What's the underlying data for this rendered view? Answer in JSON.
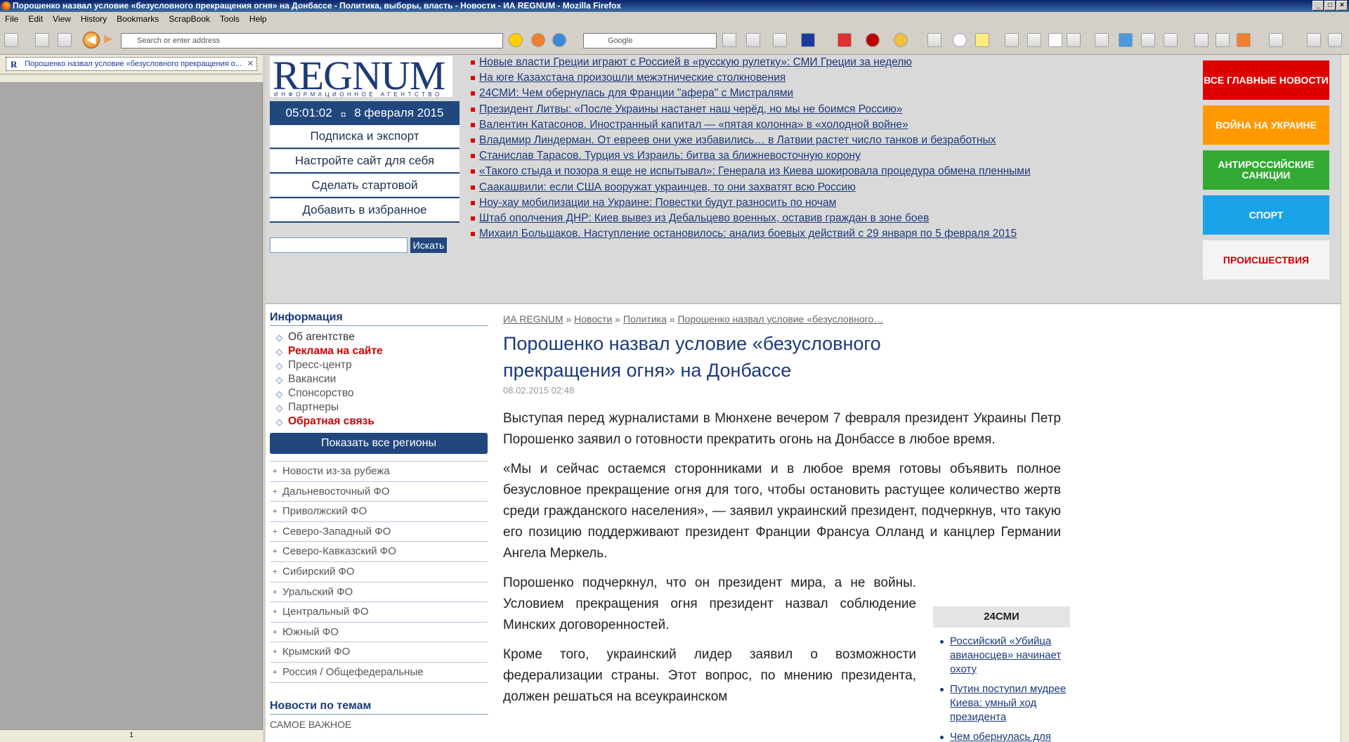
{
  "window": {
    "title": "Порошенко назвал условие «безусловного прекращения огня» на Донбассе - Политика, выборы, власть - Новости - ИА REGNUM - Mozilla Firefox"
  },
  "menu": [
    "File",
    "Edit",
    "View",
    "History",
    "Bookmarks",
    "ScrapBook",
    "Tools",
    "Help"
  ],
  "toolbar": {
    "address_placeholder": "Search or enter address",
    "search_placeholder": "Google"
  },
  "sidebar": {
    "tab_title": "Порошенко назвал условие «безусловного прекращения о...",
    "page_number": "1"
  },
  "site": {
    "logo": "REGNUM",
    "logo_sub": "ИНФОРМАЦИОННОЕ АГЕНТСТВО",
    "time": "05:01:02",
    "date": "8 февраля 2015",
    "links": [
      "Подписка и экспорт",
      "Настройте сайт для себя",
      "Сделать стартовой",
      "Добавить в избранное"
    ],
    "search_button": "Искать"
  },
  "headlines": [
    "Новые власти Греции играют с Россией в «русскую рулетку»: СМИ Греции за неделю",
    "На юге Казахстана произошли межэтнические столкновения",
    "24СМИ: Чем обернулась для Франции \"афера\" с Мистралями",
    "Президент Литвы: «После Украины настанет наш черёд, но мы не боимся Россию»",
    "Валентин Катасонов. Иностранный капитал — «пятая колонна» в «холодной войне»",
    "Владимир Линдерман. От евреев они уже избавились… в Латвии растет число танков и безработных",
    "Станислав Тарасов. Турция vs Израиль: битва за ближневосточную корону",
    "«Такого стыда и позора я еще не испытывал»: Генерала из Киева шокировала процедура обмена пленными",
    "Саакашвили: если США вооружат украинцев, то они захватят всю Россию",
    "Ноу-хау мобилизации на Украине: Повестки будут разносить по ночам",
    "Штаб ополчения ДНР: Киев вывез из Дебальцево военных, оставив граждан в зоне боев",
    "Михаил Большаков. Наступление остановилось: анализ боевых действий с 29 января по 5 февраля 2015"
  ],
  "categories": [
    {
      "label": "ВСЕ ГЛАВНЫЕ НОВОСТИ",
      "color": "#dd0000"
    },
    {
      "label": "ВОЙНА НА УКРАИНЕ",
      "color": "#ff9900"
    },
    {
      "label": "АНТИРОССИЙСКИЕ САНКЦИИ",
      "color": "#33aa33"
    },
    {
      "label": "СПОРТ",
      "color": "#1aa3e8"
    },
    {
      "label": "ПРОИСШЕСТВИЯ",
      "color": "#f4f4f4"
    }
  ],
  "info": {
    "title": "Информация",
    "items": [
      "Об агентстве",
      "Реклама на сайте",
      "Пресс-центр",
      "Вакансии",
      "Спонсорство",
      "Партнеры",
      "Обратная связь"
    ],
    "show_regions": "Показать все регионы",
    "regions": [
      "Новости из-за рубежа",
      "Дальневосточный ФО",
      "Приволжский ФО",
      "Северо-Западный ФО",
      "Северо-Кавказский ФО",
      "Сибирский ФО",
      "Уральский ФО",
      "Центральный ФО",
      "Южный ФО",
      "Крымский ФО",
      "Россия / Общефедеральные"
    ],
    "topics_title": "Новости по темам",
    "topics_first": "САМОЕ ВАЖНОЕ"
  },
  "article": {
    "crumbs": [
      "ИА REGNUM",
      "Новости",
      "Политика",
      "Порошенко назвал условие «безусловного…"
    ],
    "title": "Порошенко назвал условие «безусловного прекращения огня» на Донбассе",
    "date": "08.02.2015 02:48",
    "paragraphs": [
      "Выступая перед журналистами в Мюнхене вечером 7 февраля президент Украины Петр Порошенко заявил о готовности прекратить огонь на Донбассе в любое время.",
      "«Мы и сейчас остаемся сторонниками и в любое время готовы объявить полное безусловное прекращение огня для того, чтобы остановить растущее количество жертв среди гражданского населения», — заявил украинский президент, подчеркнув, что такую его позицию поддерживают президент Франции Франсуа Олланд и канцлер Германии Ангела Меркель.",
      "Порошенко подчеркнул, что он президент мира, а не войны. Условием прекращения огня президент назвал соблюдение Минских договоренностей.",
      "Кроме того, украинский лидер заявил о возможности федерализации страны. Этот вопрос, по мнению президента, должен решаться на всеукраинском"
    ]
  },
  "smi": {
    "title": "24СМИ",
    "items": [
      "Российский «Убийца авианосцев» начинает охоту",
      "Путин поступил мудрее Киева: умный ход президента",
      "Чем обернулась для"
    ]
  }
}
